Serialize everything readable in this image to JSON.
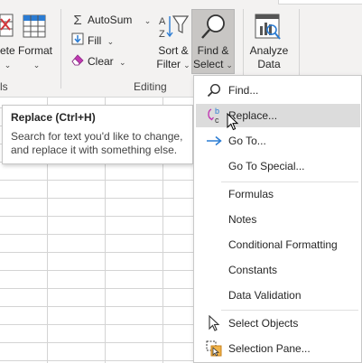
{
  "ribbon": {
    "cells_partial_label": "ete",
    "format_label": "Format",
    "cells_group_partial": "ls",
    "autosum_label": "AutoSum",
    "fill_label": "Fill",
    "clear_label": "Clear",
    "editing_group_label": "Editing",
    "sort_filter_line1": "Sort &",
    "sort_filter_line2": "Filter",
    "find_select_line1": "Find &",
    "find_select_line2": "Select",
    "analyze_line1": "Analyze",
    "analyze_line2": "Data"
  },
  "tooltip": {
    "title": "Replace (Ctrl+H)",
    "description_line1": "Search for text you'd like to change,",
    "description_line2": "and replace it with something else."
  },
  "menu": {
    "items": [
      {
        "label": "Find...",
        "icon": "search-icon"
      },
      {
        "label": "Replace...",
        "icon": "replace-icon"
      },
      {
        "label": "Go To...",
        "icon": "arrow-right-icon"
      },
      {
        "label": "Go To Special...",
        "icon": ""
      },
      {
        "label": "Formulas",
        "icon": ""
      },
      {
        "label": "Notes",
        "icon": ""
      },
      {
        "label": "Conditional Formatting",
        "icon": ""
      },
      {
        "label": "Constants",
        "icon": ""
      },
      {
        "label": "Data Validation",
        "icon": ""
      },
      {
        "label": "Select Objects",
        "icon": "pointer-icon"
      },
      {
        "label": "Selection Pane...",
        "icon": "selection-pane-icon"
      }
    ],
    "hovered_item": "Replace..."
  },
  "colors": {
    "accent_blue": "#2b7cd3",
    "hover_bg": "#dcdcdc",
    "pressed_bg": "#c8c6c4"
  }
}
